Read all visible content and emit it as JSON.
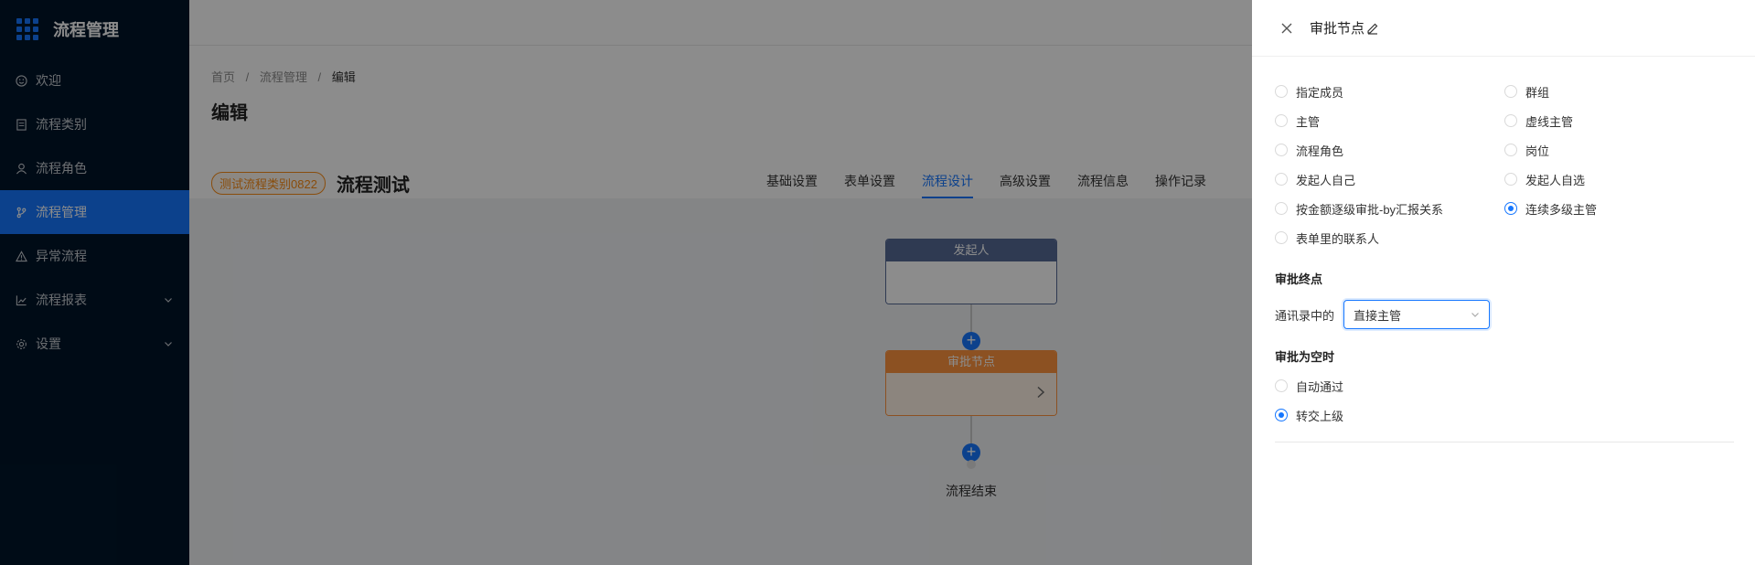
{
  "app": {
    "title": "流程管理",
    "menu": [
      {
        "label": "欢迎",
        "icon": "smile-icon",
        "active": false,
        "expandable": false
      },
      {
        "label": "流程类别",
        "icon": "list-icon",
        "active": false,
        "expandable": false
      },
      {
        "label": "流程角色",
        "icon": "user-icon",
        "active": false,
        "expandable": false
      },
      {
        "label": "流程管理",
        "icon": "branch-icon",
        "active": true,
        "expandable": false
      },
      {
        "label": "异常流程",
        "icon": "warning-icon",
        "active": false,
        "expandable": false
      },
      {
        "label": "流程报表",
        "icon": "chart-icon",
        "active": false,
        "expandable": true
      },
      {
        "label": "设置",
        "icon": "gear-icon",
        "active": false,
        "expandable": true
      }
    ]
  },
  "breadcrumb": [
    "首页",
    "流程管理",
    "编辑"
  ],
  "page_title": "编辑",
  "flow": {
    "category_tag": "测试流程类别0822",
    "title": "流程测试",
    "tabs": [
      {
        "label": "基础设置",
        "active": false
      },
      {
        "label": "表单设置",
        "active": false
      },
      {
        "label": "流程设计",
        "active": true
      },
      {
        "label": "高级设置",
        "active": false
      },
      {
        "label": "流程信息",
        "active": false
      },
      {
        "label": "操作记录",
        "active": false
      }
    ]
  },
  "canvas": {
    "start_node": "发起人",
    "approve_node": "审批节点",
    "add_symbol": "+",
    "end_label": "流程结束"
  },
  "drawer": {
    "title": "审批节点",
    "approver_types": [
      {
        "label": "指定成员",
        "checked": false
      },
      {
        "label": "群组",
        "checked": false
      },
      {
        "label": "主管",
        "checked": false
      },
      {
        "label": "虚线主管",
        "checked": false
      },
      {
        "label": "流程角色",
        "checked": false
      },
      {
        "label": "岗位",
        "checked": false
      },
      {
        "label": "发起人自己",
        "checked": false
      },
      {
        "label": "发起人自选",
        "checked": false
      },
      {
        "label": "按金额逐级审批-by汇报关系",
        "checked": false
      },
      {
        "label": "连续多级主管",
        "checked": true
      },
      {
        "label": "表单里的联系人",
        "checked": false
      }
    ],
    "endpoint": {
      "section_title": "审批终点",
      "label": "通讯录中的",
      "selected": "直接主管"
    },
    "empty": {
      "section_title": "审批为空时",
      "options": [
        {
          "label": "自动通过",
          "checked": false
        },
        {
          "label": "转交上级",
          "checked": true
        }
      ]
    }
  },
  "colors": {
    "sidebar_bg": "#001529",
    "accent": "#1677ff",
    "start_node": "#576a95",
    "approve_node": "#ff943e",
    "tag": "#fa8c16"
  }
}
